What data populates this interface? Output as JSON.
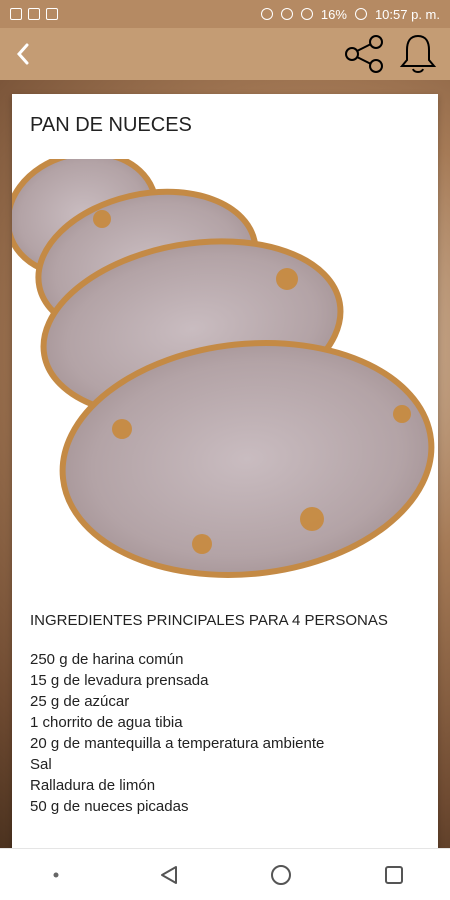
{
  "status_bar": {
    "battery": "16%",
    "time": "10:57 p. m."
  },
  "app_bar": {
    "back_icon": "back-icon",
    "share_icon": "share-icon",
    "bell_icon": "bell-icon"
  },
  "recipe": {
    "title": "PAN DE NUECES",
    "ingredients_heading": "INGREDIENTES PRINCIPALES PARA 4 PERSONAS",
    "ingredients": [
      "250 g de harina común",
      "15 g de levadura prensada",
      "25 g de azúcar",
      "1 chorrito de agua tibia",
      "20 g de mantequilla a temperatura ambiente",
      "Sal",
      "Ralladura de limón",
      "50 g de nueces picadas"
    ]
  },
  "nav_bar": {
    "back": "triangle-back-icon",
    "home": "home-circle-icon",
    "recents": "recents-square-icon"
  },
  "colors": {
    "status_bar": "#b58a63",
    "app_bar": "#c49c74"
  }
}
